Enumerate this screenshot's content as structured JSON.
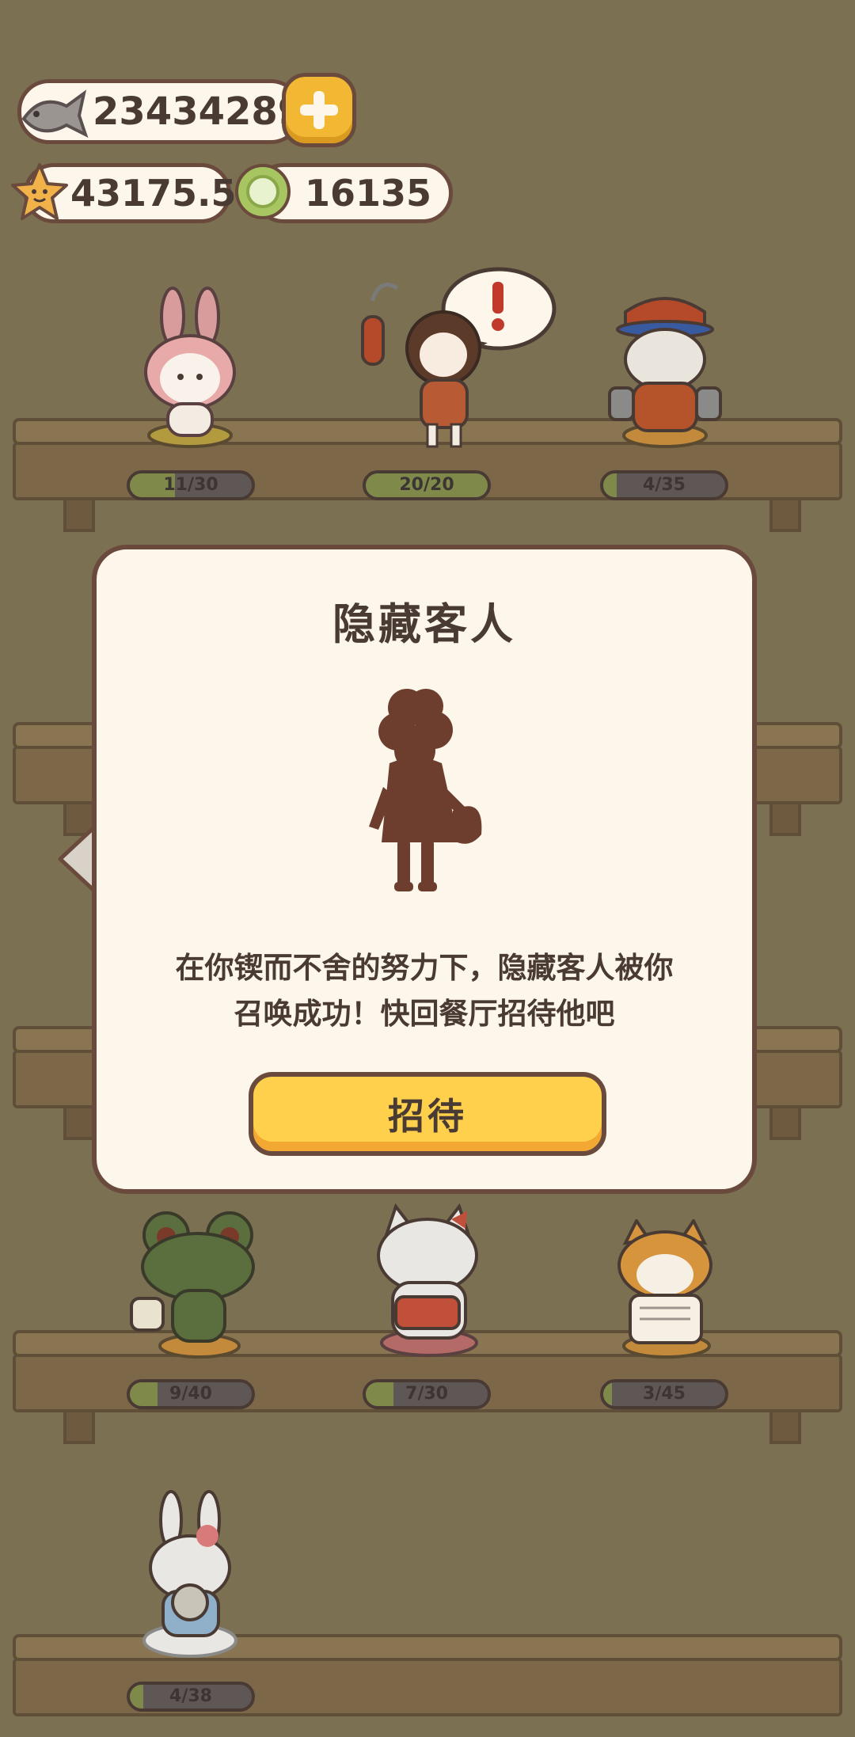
{
  "currency": {
    "fish": "23434289",
    "star": "43175.5",
    "gem": "16135"
  },
  "shelves": [
    {
      "slots": [
        {
          "name": "bunny-hood",
          "count": "11/30",
          "fill": 0.37
        },
        {
          "name": "girl-with-keys",
          "count": "20/20",
          "fill": 1.0
        },
        {
          "name": "cap-dog",
          "count": "4/35",
          "fill": 0.11
        }
      ]
    },
    {
      "slots": [
        {
          "name": "frog",
          "count": "9/40",
          "fill": 0.23
        },
        {
          "name": "white-cat",
          "count": "7/30",
          "fill": 0.23
        },
        {
          "name": "shiba-newspaper",
          "count": "3/45",
          "fill": 0.07
        }
      ]
    },
    {
      "slots": [
        {
          "name": "rabbit-drum",
          "count": "4/38",
          "fill": 0.11
        }
      ]
    }
  ],
  "dialog": {
    "title": "隐藏客人",
    "line1": "在你锲而不舍的努力下，隐藏客人被你",
    "line2": "召唤成功！快回餐厅招待他吧",
    "button": "招待"
  },
  "icons": [
    "fish-icon",
    "star-icon",
    "gem-icon",
    "plus-icon",
    "exclamation-icon",
    "left-arrow-icon"
  ]
}
